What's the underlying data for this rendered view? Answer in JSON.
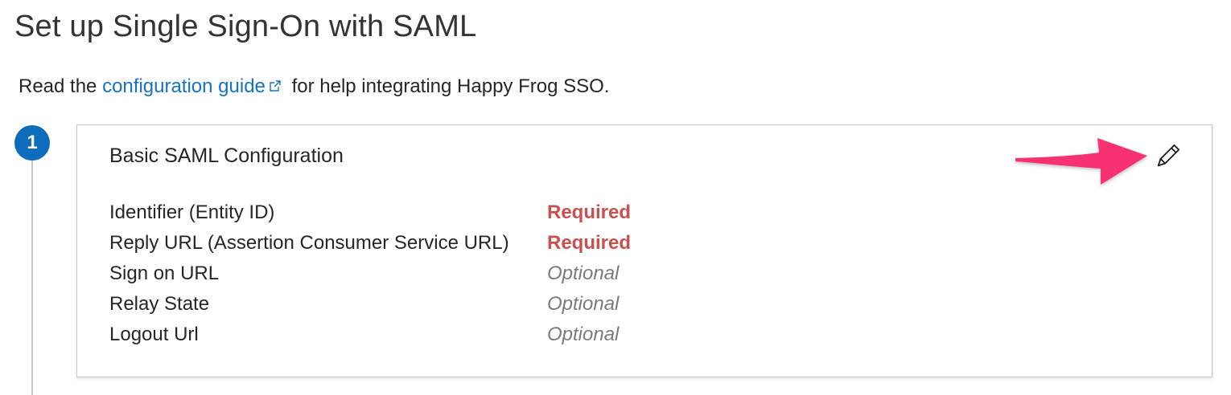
{
  "page": {
    "title": "Set up Single Sign-On with SAML"
  },
  "intro": {
    "prefix": "Read the ",
    "link_text": "configuration guide",
    "suffix": " for help integrating Happy Frog SSO."
  },
  "step": {
    "number": "1"
  },
  "card": {
    "title": "Basic SAML Configuration",
    "fields": [
      {
        "label": "Identifier (Entity ID)",
        "status": "Required"
      },
      {
        "label": "Reply URL (Assertion Consumer Service URL)",
        "status": "Required"
      },
      {
        "label": "Sign on URL",
        "status": "Optional"
      },
      {
        "label": "Relay State",
        "status": "Optional"
      },
      {
        "label": "Logout Url",
        "status": "Optional"
      }
    ]
  },
  "icons": {
    "external_link": "external-link-icon",
    "edit": "pencil-icon",
    "annotation": "arrow-annotation"
  },
  "colors": {
    "link": "#1572c4",
    "step_badge": "#0f6cbd",
    "required": "#c9504f",
    "optional": "#7a7a7a",
    "annotation_arrow": "#f7336f"
  }
}
